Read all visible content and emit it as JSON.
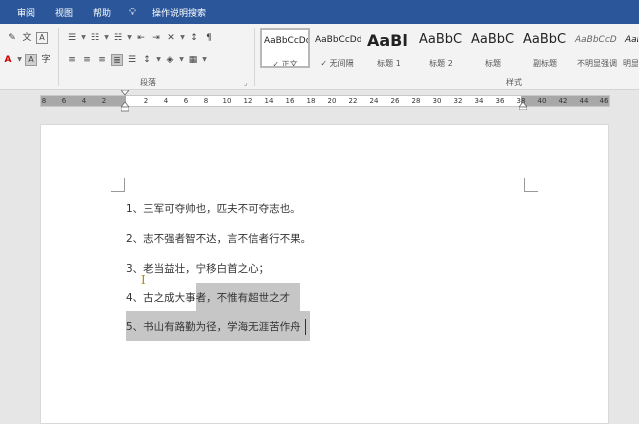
{
  "menu": {
    "items": [
      "审阅",
      "视图",
      "帮助"
    ],
    "tell_me": "操作说明搜索"
  },
  "ribbon": {
    "paragraph_group_label": "段落",
    "styles_group_label": "样式",
    "styles": [
      {
        "sample": "AaBbCcDd",
        "name": "正文",
        "check": "✓"
      },
      {
        "sample": "AaBbCcDd",
        "name": "无间隔",
        "check": "✓"
      },
      {
        "sample": "AaBl",
        "name": "标题 1"
      },
      {
        "sample": "AaBbC",
        "name": "标题 2"
      },
      {
        "sample": "AaBbC",
        "name": "标题"
      },
      {
        "sample": "AaBbC",
        "name": "副标题"
      },
      {
        "sample": "AaBbCcD",
        "name": "不明显强调"
      },
      {
        "sample": "AaBb",
        "name": "明显强"
      }
    ],
    "font_icons": {
      "eraser": "✎",
      "pinyin": "文",
      "border_char": "A",
      "font_color": "A",
      "shade_char": "A",
      "enclose_char": "字"
    }
  },
  "ruler": {
    "ticks": [
      "8",
      "6",
      "4",
      "2",
      "2",
      "4",
      "6",
      "8",
      "10",
      "12",
      "14",
      "16",
      "18",
      "20",
      "22",
      "24",
      "26",
      "28",
      "30",
      "32",
      "34",
      "36",
      "38",
      "40",
      "42",
      "44",
      "46",
      "48"
    ]
  },
  "document": {
    "lines": [
      "1、三军可夺帅也，匹夫不可夺志也。",
      "2、志不强者智不达，言不信者行不果。",
      "3、老当益壮，宁移白首之心；",
      "4、古之成大事者，不惟有超世之才",
      "5、书山有路勤为径，学海无涯苦作舟"
    ],
    "line4_unselected": "4、古之成大事",
    "line4_selected": "者，不惟有超世之才"
  },
  "colors": {
    "accent": "#2b579a",
    "selection": "#c6c6c6"
  }
}
